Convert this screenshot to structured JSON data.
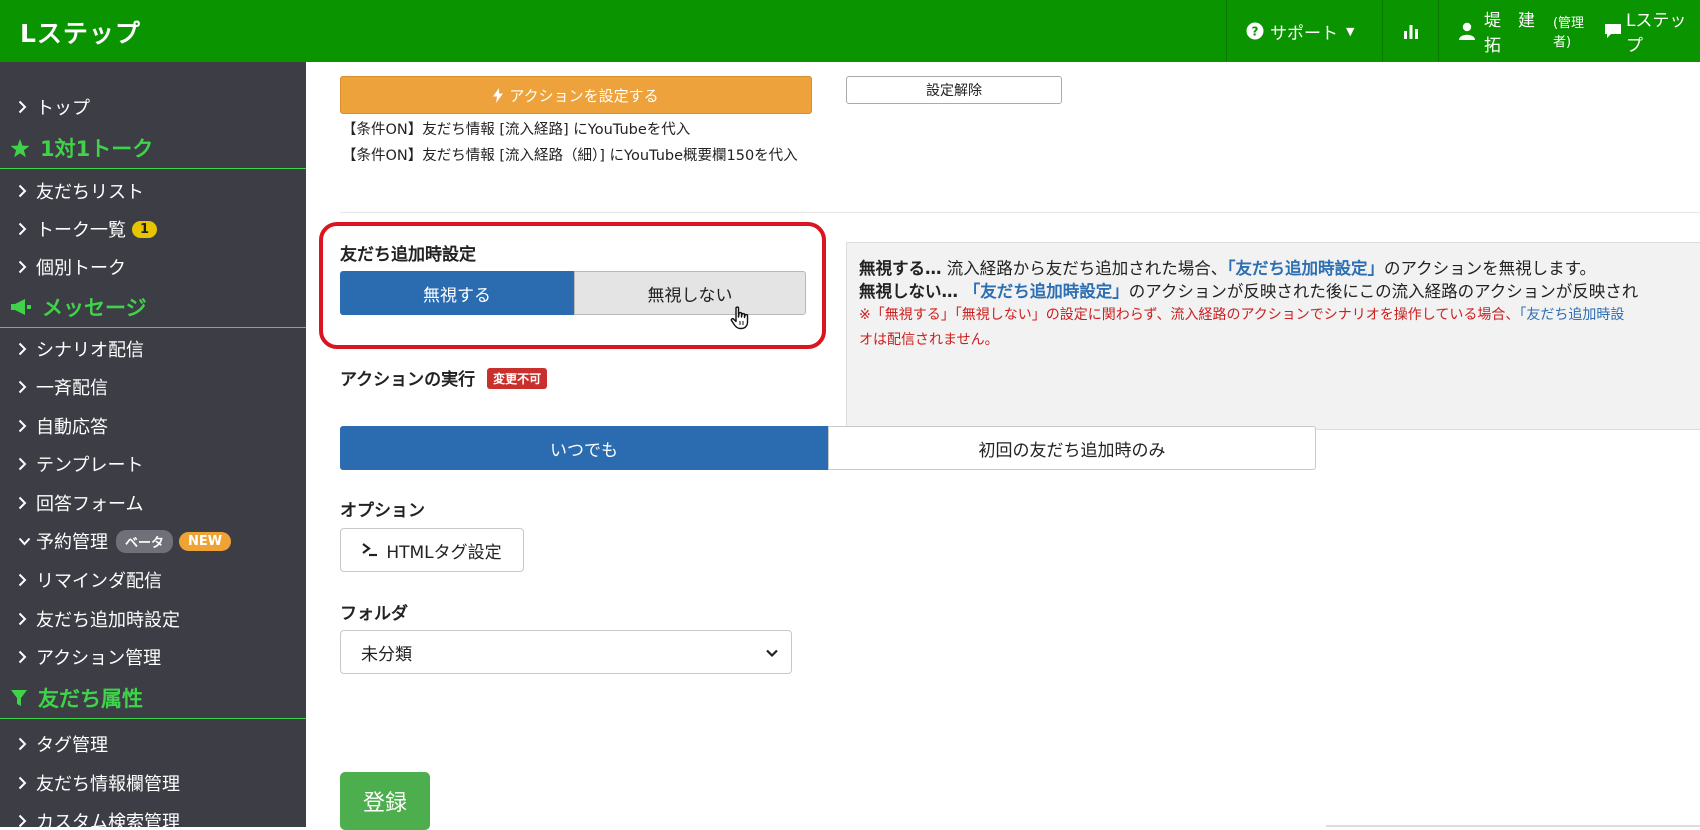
{
  "brand": {
    "logo_text": "Lステップ",
    "primary_color": "#0a9400",
    "accent_green": "#3fd34a"
  },
  "header": {
    "support_label": "サポート",
    "user_name": "堤　建拓",
    "user_role": "(管理者)",
    "account_label": "Lステップ",
    "icons": [
      "question-circle-icon",
      "bar-chart-icon",
      "user-icon",
      "chat-icon"
    ]
  },
  "sidebar": {
    "items": [
      {
        "kind": "link",
        "label": "トップ"
      },
      {
        "kind": "heading",
        "label": "1対1トーク",
        "icon": "star-icon"
      },
      {
        "kind": "link",
        "label": "友だちリスト"
      },
      {
        "kind": "link",
        "label": "トーク一覧",
        "badge": "1"
      },
      {
        "kind": "link",
        "label": "個別トーク"
      },
      {
        "kind": "heading",
        "label": "メッセージ",
        "icon": "megaphone-icon"
      },
      {
        "kind": "link",
        "label": "シナリオ配信"
      },
      {
        "kind": "link",
        "label": "一斉配信"
      },
      {
        "kind": "link",
        "label": "自動応答"
      },
      {
        "kind": "link",
        "label": "テンプレート"
      },
      {
        "kind": "link",
        "label": "回答フォーム"
      },
      {
        "kind": "link",
        "label": "予約管理",
        "expanded": true,
        "beta_badge": "ベータ",
        "new_badge": "NEW"
      },
      {
        "kind": "link",
        "label": "リマインダ配信"
      },
      {
        "kind": "link",
        "label": "友だち追加時設定"
      },
      {
        "kind": "link",
        "label": "アクション管理"
      },
      {
        "kind": "heading",
        "label": "友だち属性",
        "icon": "filter-icon"
      },
      {
        "kind": "link",
        "label": "タグ管理"
      },
      {
        "kind": "link",
        "label": "友だち情報欄管理"
      },
      {
        "kind": "link",
        "label": "カスタム検索管理"
      }
    ]
  },
  "main": {
    "action_button": "アクションを設定する",
    "release_button": "設定解除",
    "conditions": [
      "【条件ON】友だち情報 [流入経路] にYouTubeを代入",
      "【条件ON】友だち情報 [流入経路（細）] にYouTube概要欄150を代入"
    ],
    "friend_add_setting": {
      "label": "友だち追加時設定",
      "options": [
        "無視する",
        "無視しない"
      ],
      "selected": "無視する"
    },
    "info": {
      "line1_bold": "無視する…",
      "line1_a": " 流入経路から友だち追加された場合、",
      "line1_link": "「友だち追加時設定」",
      "line1_b": "のアクションを無視します。",
      "line2_bold": "無視しない…",
      "line2_link": " 「友だち追加時設定」",
      "line2_a": "のアクションが反映された後にこの流入経路のアクションが反映され",
      "warn1_a": "※「無視する」「無視しない」の設定に関わらず、流入経路のアクションでシナリオを操作している場合、",
      "warn1_link": "「友だち追加時設",
      "warn2": "オは配信されません。"
    },
    "action_exec": {
      "label": "アクションの実行",
      "badge": "変更不可",
      "options": [
        "いつでも",
        "初回の友だち追加時のみ"
      ],
      "selected": "いつでも"
    },
    "option": {
      "label": "オプション",
      "html_tag_button": "HTMLタグ設定"
    },
    "folder": {
      "label": "フォルダ",
      "selected": "未分類"
    },
    "submit": "登録"
  }
}
